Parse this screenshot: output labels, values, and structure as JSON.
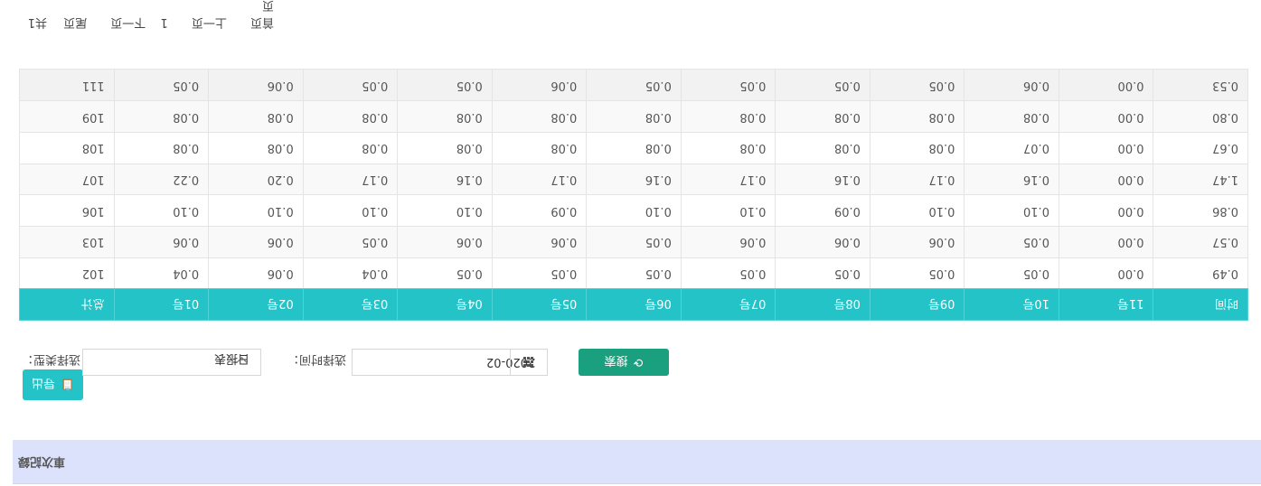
{
  "title": "車次記録",
  "toolbar": {
    "export_label": "导出"
  },
  "filters": {
    "type_label": "选择类型：",
    "type_value": "日报表",
    "date_label": "选择时间：",
    "date_value": "2020-02",
    "search_label": "搜索"
  },
  "table": {
    "headers": [
      "时间",
      "11号",
      "10号",
      "09号",
      "08号",
      "07号",
      "06号",
      "05号",
      "04号",
      "03号",
      "02号",
      "01号",
      "总计"
    ],
    "rows": [
      [
        "0.49",
        "0.00",
        "0.05",
        "0.05",
        "0.05",
        "0.05",
        "0.05",
        "0.05",
        "0.05",
        "0.04",
        "0.06",
        "0.04",
        "102"
      ],
      [
        "0.57",
        "0.00",
        "0.05",
        "0.06",
        "0.06",
        "0.06",
        "0.05",
        "0.06",
        "0.06",
        "0.05",
        "0.06",
        "0.06",
        "103"
      ],
      [
        "0.86",
        "0.00",
        "0.10",
        "0.10",
        "0.09",
        "0.10",
        "0.10",
        "0.09",
        "0.10",
        "0.10",
        "0.10",
        "0.10",
        "106"
      ],
      [
        "1.47",
        "0.00",
        "0.16",
        "0.17",
        "0.16",
        "0.17",
        "0.16",
        "0.17",
        "0.16",
        "0.17",
        "0.20",
        "0.22",
        "107"
      ],
      [
        "0.67",
        "0.00",
        "0.07",
        "0.08",
        "0.08",
        "0.08",
        "0.08",
        "0.08",
        "0.08",
        "0.08",
        "0.08",
        "0.08",
        "108"
      ],
      [
        "0.80",
        "0.00",
        "0.08",
        "0.08",
        "0.08",
        "0.08",
        "0.08",
        "0.08",
        "0.08",
        "0.08",
        "0.08",
        "0.08",
        "109"
      ],
      [
        "0.53",
        "0.00",
        "0.06",
        "0.05",
        "0.05",
        "0.05",
        "0.05",
        "0.06",
        "0.05",
        "0.05",
        "0.06",
        "0.05",
        "111"
      ]
    ]
  },
  "pager": {
    "first": "首页",
    "prev": "上一页",
    "page": "1",
    "next": "下一页",
    "last": "尾页",
    "total": "共1页"
  }
}
